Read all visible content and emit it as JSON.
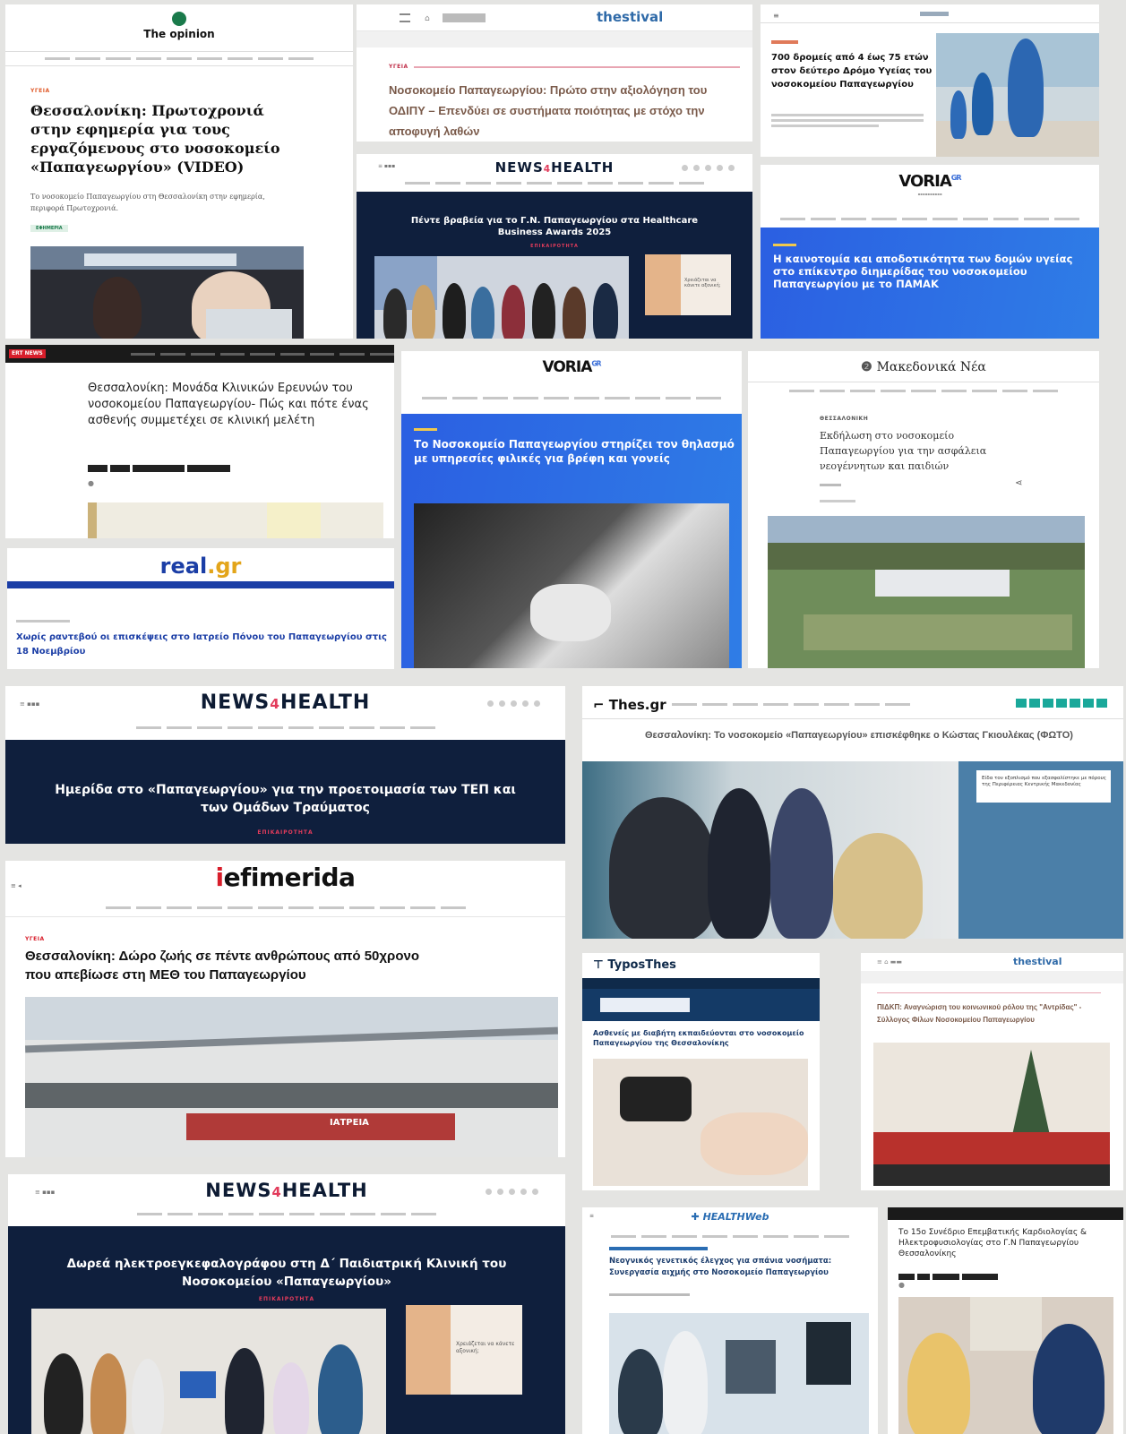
{
  "theopinion": {
    "brand": "The opinion",
    "section": "ΥΓΕΙΑ",
    "headline": "Θεσσαλονίκη: Πρωτοχρονιά στην εφημερία για τους εργαζόμενους στο νοσοκομείο «Παπαγεωργίου» (VIDEO)",
    "summary": "Το νοσοκομείο Παπαγεωργίου στη Θεσσαλονίκη στην εφημερία, περιφορά Πρωτοχρονιά.",
    "tag": "ΕΦΗΜΕΡΙΑ"
  },
  "thestival_1": {
    "brand": "thestival",
    "section": "ΥΓΕΙΑ",
    "headline": "Νοσοκομείο Παπαγεωργίου: Πρώτο στην αξιολόγηση του ΟΔΙΠΥ – Επενδύει σε συστήματα ποιότητας με στόχο την αποφυγή λαθών"
  },
  "runners": {
    "headline": "700 δρομείς από 4 έως 75 ετών στον δεύτερο Δρόμο Υγείας του νοσοκομείου Παπαγεωργίου"
  },
  "n4h_1": {
    "brand_a": "NEWS",
    "brand_b": "4",
    "brand_c": "HEALTH",
    "headline": "Πέντε βραβεία για το Γ.Ν. Παπαγεωργίου στα Healthcare Business Awards 2025",
    "kicker": "ΕΠΙΚΑΙΡΟΤΗΤΑ",
    "ad_text": "Χρειάζεται να κάνετε αξονική;"
  },
  "voria_1": {
    "brand": "VORIA",
    "brand_sup": "GR",
    "headline": "Η καινοτομία και αποδοτικότητα των δομών υγείας στο επίκεντρο διημερίδας του νοσοκομείου Παπαγεωργίου με το ΠΑΜΑΚ"
  },
  "ertnews": {
    "brand": "ERT NEWS",
    "headline": "Θεσσαλονίκη: Μονάδα Κλινικών Ερευνών του νοσοκομείου Παπαγεωργίου- Πώς και πότε ένας ασθενής συμμετέχει σε κλινική μελέτη"
  },
  "voria_2": {
    "brand": "VORIA",
    "brand_sup": "GR",
    "headline": "Το Νοσοκομείο Παπαγεωργίου στηρίζει τον θηλασμό με υπηρεσίες φιλικές για βρέφη και γονείς"
  },
  "makedonika": {
    "brand": "Μακεδονικά Νέα",
    "section": "ΘΕΣΣΑΛΟΝΙΚΗ",
    "headline": "Εκδήλωση στο νοσοκομείο Παπαγεωργίου για την ασφάλεια νεογέννητων και παιδιών"
  },
  "realgr": {
    "brand_a": "real",
    "brand_b": ".gr",
    "headline": "Χωρίς ραντεβού οι επισκέψεις στο Ιατρείο Πόνου του Παπαγεωργίου στις 18 Νοεμβρίου"
  },
  "n4h_2": {
    "brand_a": "NEWS",
    "brand_b": "4",
    "brand_c": "HEALTH",
    "headline": "Ημερίδα στο «Παπαγεωργίου» για την προετοιμασία των ΤΕΠ και των Ομάδων Τραύματος",
    "kicker": "ΕΠΙΚΑΙΡΟΤΗΤΑ"
  },
  "thesgr": {
    "brand": "Thes.gr",
    "headline": "Θεσσαλονίκη: Το νοσοκομείο «Παπαγεωργίου» επισκέφθηκε ο Κώστας Γκιουλέκας (ΦΩΤΟ)",
    "caption": "Είδα τον εξοπλισμό που εξασφαλίστηκε με πόρους της Περιφέρειας Κεντρικής Μακεδονίας"
  },
  "iefimerida": {
    "brand_a": "i",
    "brand_b": "efimerida",
    "section": "ΥΓΕΙΑ",
    "headline": "Θεσσαλονίκη: Δώρο ζωής σε πέντε ανθρώπους από 50χρονο που απεβίωσε στη ΜΕΘ του Παπαγεωργίου",
    "building_sign": "ΙΑΤΡΕΙΑ"
  },
  "typosthes": {
    "brand": "TyposThes",
    "headline": "Ασθενείς με διαβήτη εκπαιδεύονται στο νοσοκομείο Παπαγεωργίου της Θεσσαλονίκης"
  },
  "thestival_2": {
    "brand": "thestival",
    "headline": "ΠΙΔΚΠ: Αναγνώριση του κοινωνικού ρόλου της \"Αντρίδας\" - Σύλλογος Φίλων Νοσοκομείου Παπαγεωργίου"
  },
  "n4h_3": {
    "brand_a": "NEWS",
    "brand_b": "4",
    "brand_c": "HEALTH",
    "headline": "Δωρεά ηλεκτροεγκεφαλογράφου στη Δ΄ Παιδιατρική Κλινική του Νοσοκομείου «Παπαγεωργίου»",
    "kicker": "ΕΠΙΚΑΙΡΟΤΗΤΑ",
    "ad_text": "Χρειάζεται να κάνετε αξονική;"
  },
  "healthweb": {
    "brand": "HEALTHWeb",
    "headline": "Νεογνικός γενετικός έλεγχος για σπάνια νοσήματα: Συνεργασία αιχμής στο Νοσοκομείο Παπαγεωργίου"
  },
  "cardio": {
    "headline": "Το 15ο Συνέδριο Επεμβατικής Καρδιολογίας & Ηλεκτροφυσιολογίας στο Γ.Ν Παπαγεωργίου Θεσσαλονίκης"
  },
  "colors": {
    "n4h_navy": "#0f1f3d",
    "n4h_pink": "#e23b5b",
    "voria_blue": "#2d63e6",
    "real_blue": "#1b3ea6",
    "thes_teal": "#1aa89a",
    "ert_red": "#d81e2b"
  }
}
